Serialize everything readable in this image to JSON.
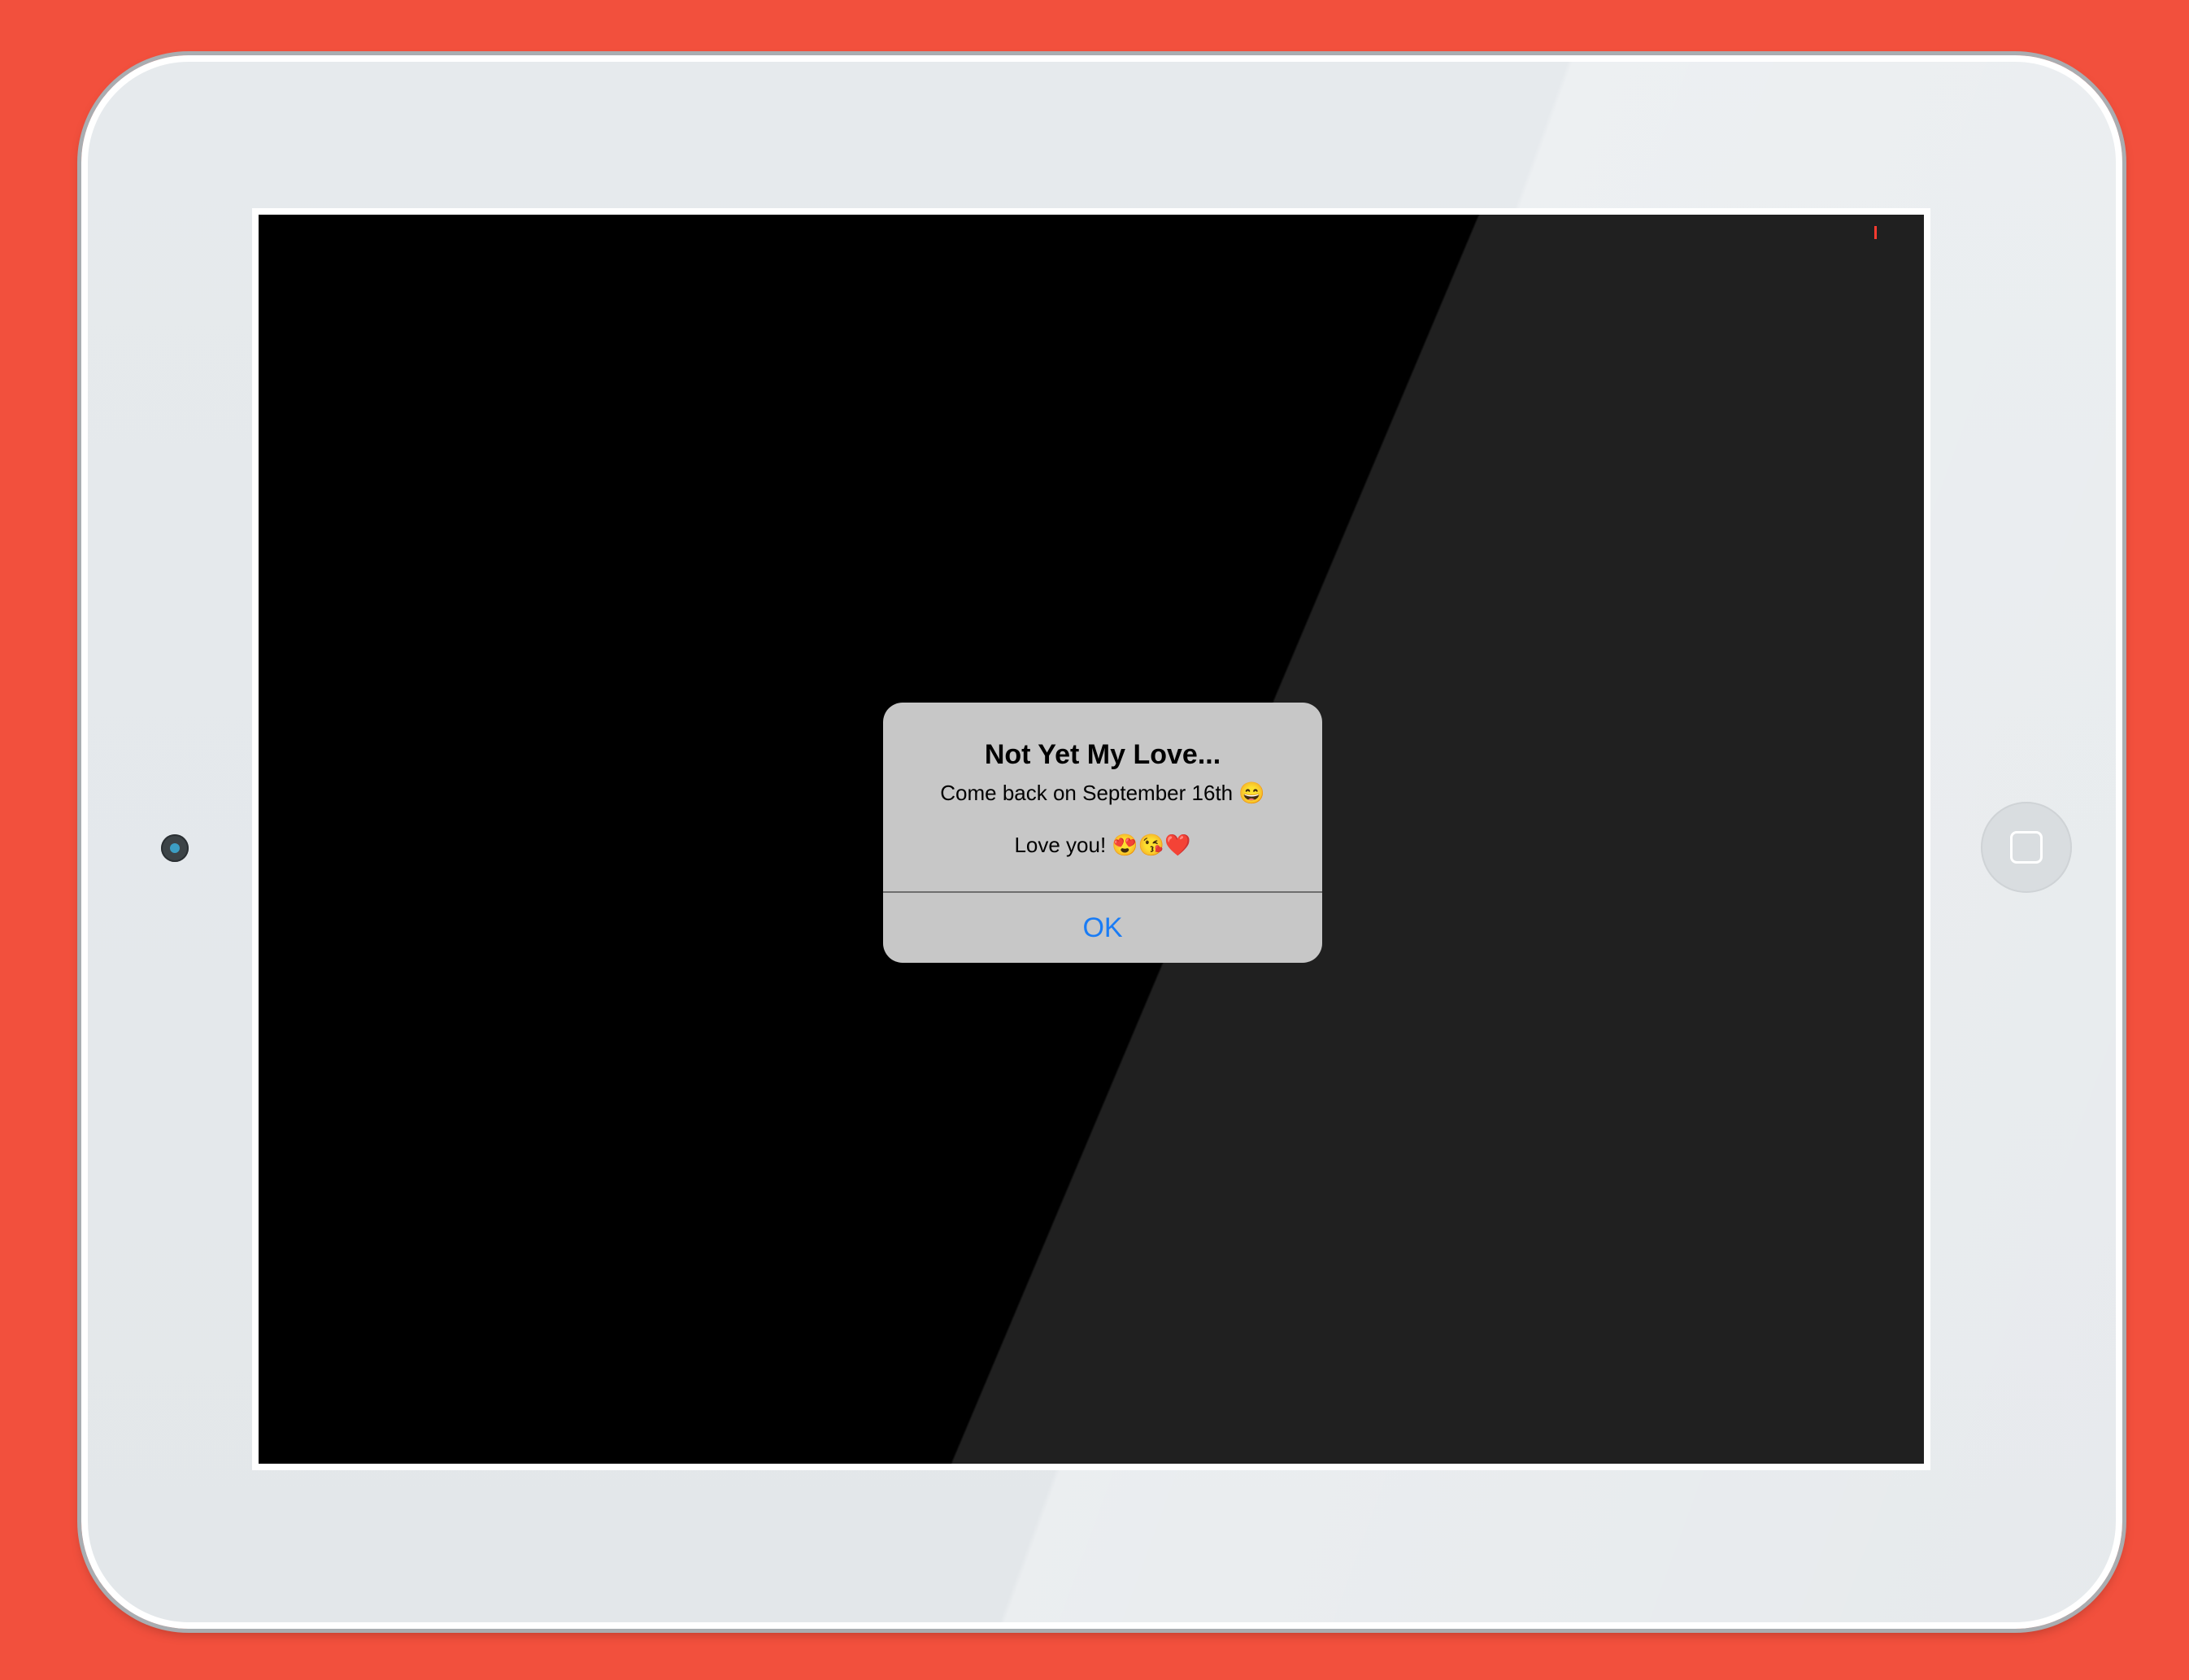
{
  "alert": {
    "title": "Not Yet My Love...",
    "message_line1": "Come back on September 16th 😄",
    "message_line2": "Love you! 😍😘❤️",
    "ok_label": "OK"
  },
  "colors": {
    "background": "#f2503d",
    "device_body": "#e6eaed",
    "screen": "#000000",
    "alert_bg": "#c7c7c7",
    "button_text": "#1a7cf5",
    "status_marker": "#ff3b30"
  },
  "icons": {
    "front_camera": "camera-icon",
    "home_button": "square-icon"
  }
}
